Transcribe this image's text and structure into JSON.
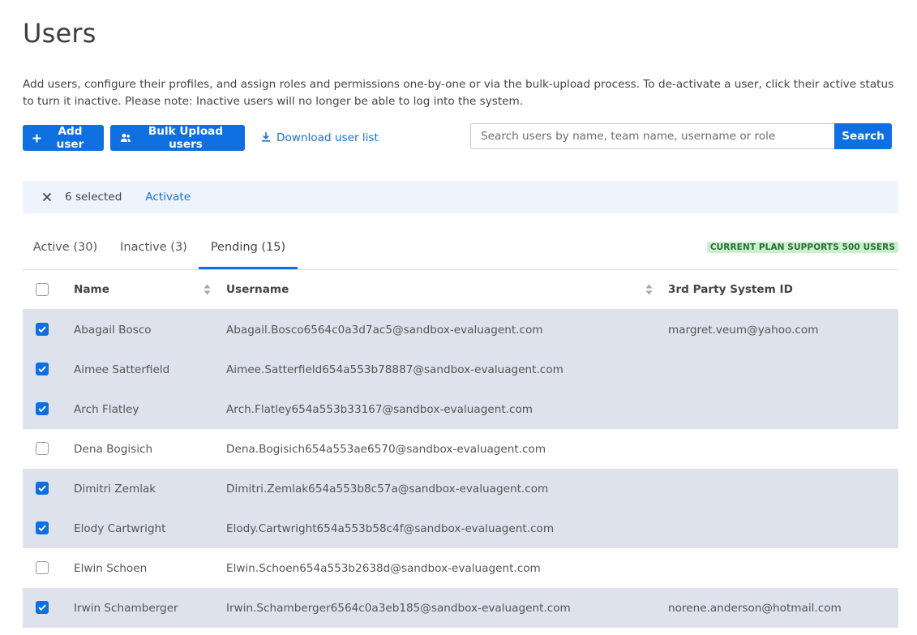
{
  "page": {
    "title": "Users",
    "description": "Add users, configure their profiles, and assign roles and permissions one-by-one or via the bulk-upload process. To de-activate a user, click their active status to turn it inactive. Please note: Inactive users will no longer be able to log into the system."
  },
  "toolbar": {
    "add_user_label": "Add user",
    "bulk_upload_label": "Bulk Upload users",
    "download_label": "Download user list"
  },
  "search": {
    "placeholder": "Search users by name, team name, username or role",
    "value": "",
    "button_label": "Search"
  },
  "selection": {
    "count_label": "6 selected",
    "activate_label": "Activate"
  },
  "tabs": [
    {
      "label": "Active (30)",
      "active": false
    },
    {
      "label": "Inactive (3)",
      "active": false
    },
    {
      "label": "Pending (15)",
      "active": true
    }
  ],
  "plan_badge": "CURRENT PLAN SUPPORTS 500 USERS",
  "table": {
    "headers": {
      "name": "Name",
      "username": "Username",
      "system_id": "3rd Party System ID"
    },
    "rows": [
      {
        "checked": true,
        "name": "Abagail Bosco",
        "username": "Abagail.Bosco6564c0a3d7ac5@sandbox-evaluagent.com",
        "system_id": "margret.veum@yahoo.com"
      },
      {
        "checked": true,
        "name": "Aimee Satterfield",
        "username": "Aimee.Satterfield654a553b78887@sandbox-evaluagent.com",
        "system_id": ""
      },
      {
        "checked": true,
        "name": "Arch Flatley",
        "username": "Arch.Flatley654a553b33167@sandbox-evaluagent.com",
        "system_id": ""
      },
      {
        "checked": false,
        "name": "Dena Bogisich",
        "username": "Dena.Bogisich654a553ae6570@sandbox-evaluagent.com",
        "system_id": ""
      },
      {
        "checked": true,
        "name": "Dimitri Zemlak",
        "username": "Dimitri.Zemlak654a553b8c57a@sandbox-evaluagent.com",
        "system_id": ""
      },
      {
        "checked": true,
        "name": "Elody Cartwright",
        "username": "Elody.Cartwright654a553b58c4f@sandbox-evaluagent.com",
        "system_id": ""
      },
      {
        "checked": false,
        "name": "Elwin Schoen",
        "username": "Elwin.Schoen654a553b2638d@sandbox-evaluagent.com",
        "system_id": ""
      },
      {
        "checked": true,
        "name": "Irwin Schamberger",
        "username": "Irwin.Schamberger6564c0a3eb185@sandbox-evaluagent.com",
        "system_id": "norene.anderson@hotmail.com"
      }
    ]
  },
  "colors": {
    "primary": "#0e6fe0",
    "selected_row": "#dde2ec",
    "selection_bar": "#eef4fd",
    "badge_bg": "#c9f0cf",
    "badge_text": "#2f6b35"
  }
}
